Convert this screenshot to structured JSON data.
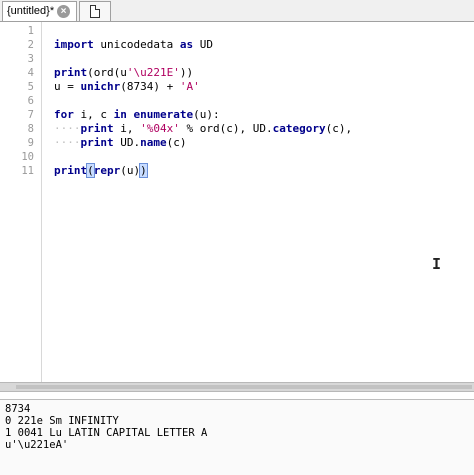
{
  "tab": {
    "title": "{untitled}*",
    "close_glyph": "×",
    "new_icon": "document-icon"
  },
  "lines": [
    "1",
    "2",
    "3",
    "4",
    "5",
    "6",
    "7",
    "8",
    "9",
    "10",
    "11"
  ],
  "code": {
    "l2": {
      "kw1": "import",
      "mod": " unicodedata ",
      "kw2": "as",
      "alias": " UD"
    },
    "l4": {
      "fn": "print",
      "a": "(ord(u",
      "s": "'\\u221E'",
      "b": "))"
    },
    "l5": {
      "a": "u = ",
      "fn": "unichr",
      "b": "(8734) + ",
      "s": "'A'"
    },
    "l7": {
      "kw1": "for",
      "a": " i, c ",
      "kw2": "in",
      "sp": " ",
      "fn": "enumerate",
      "b": "(u):"
    },
    "l8": {
      "ws": "····",
      "fn": "print",
      "a": " i, ",
      "s": "'%04x'",
      "b": " % ord(c), UD.",
      "fn2": "category",
      "c": "(c),"
    },
    "l9": {
      "ws": "····",
      "fn": "print",
      "a": " UD.",
      "fn2": "name",
      "b": "(c)"
    },
    "l11": {
      "fn": "print",
      "p1": "(",
      "fn2": "repr",
      "a": "(u)",
      "p2": ")"
    }
  },
  "output": [
    "8734",
    "0 221e Sm INFINITY",
    "1 0041 Lu LATIN CAPITAL LETTER A",
    "u'\\u221eA'"
  ],
  "colors": {
    "keyword": "#00008b",
    "string": "#b00060",
    "gutter_text": "#999999"
  },
  "cursor_icon": "text-cursor-icon"
}
